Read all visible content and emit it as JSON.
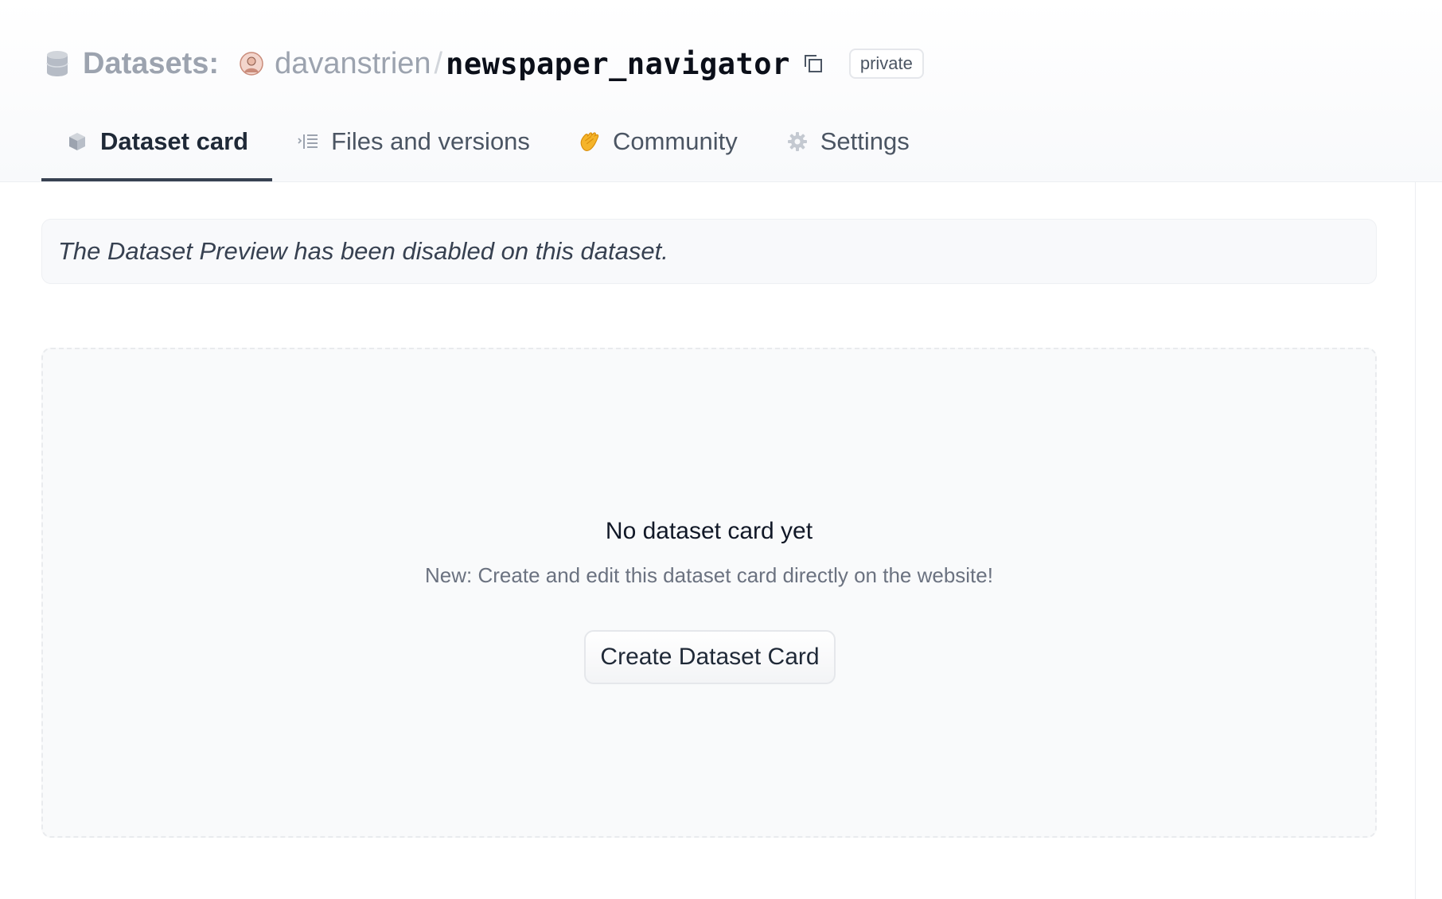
{
  "header": {
    "section_label": "Datasets:",
    "owner": "davanstrien",
    "separator": "/",
    "repo_name": "newspaper_navigator",
    "visibility_badge": "private"
  },
  "tabs": [
    {
      "label": "Dataset card",
      "icon": "cube-icon",
      "active": true
    },
    {
      "label": "Files and versions",
      "icon": "files-list-icon",
      "active": false
    },
    {
      "label": "Community",
      "icon": "clapping-hands-icon",
      "active": false
    },
    {
      "label": "Settings",
      "icon": "gear-icon",
      "active": false
    }
  ],
  "notice": {
    "text": "The Dataset Preview has been disabled on this dataset."
  },
  "empty_card": {
    "title": "No dataset card yet",
    "subtitle": "New: Create and edit this dataset card directly on the website!",
    "button_label": "Create Dataset Card"
  },
  "colors": {
    "muted_text": "#9ca3af",
    "repo_text": "#0b0f19",
    "active_tab_underline": "#374151",
    "community_icon": "#f5b42a"
  }
}
